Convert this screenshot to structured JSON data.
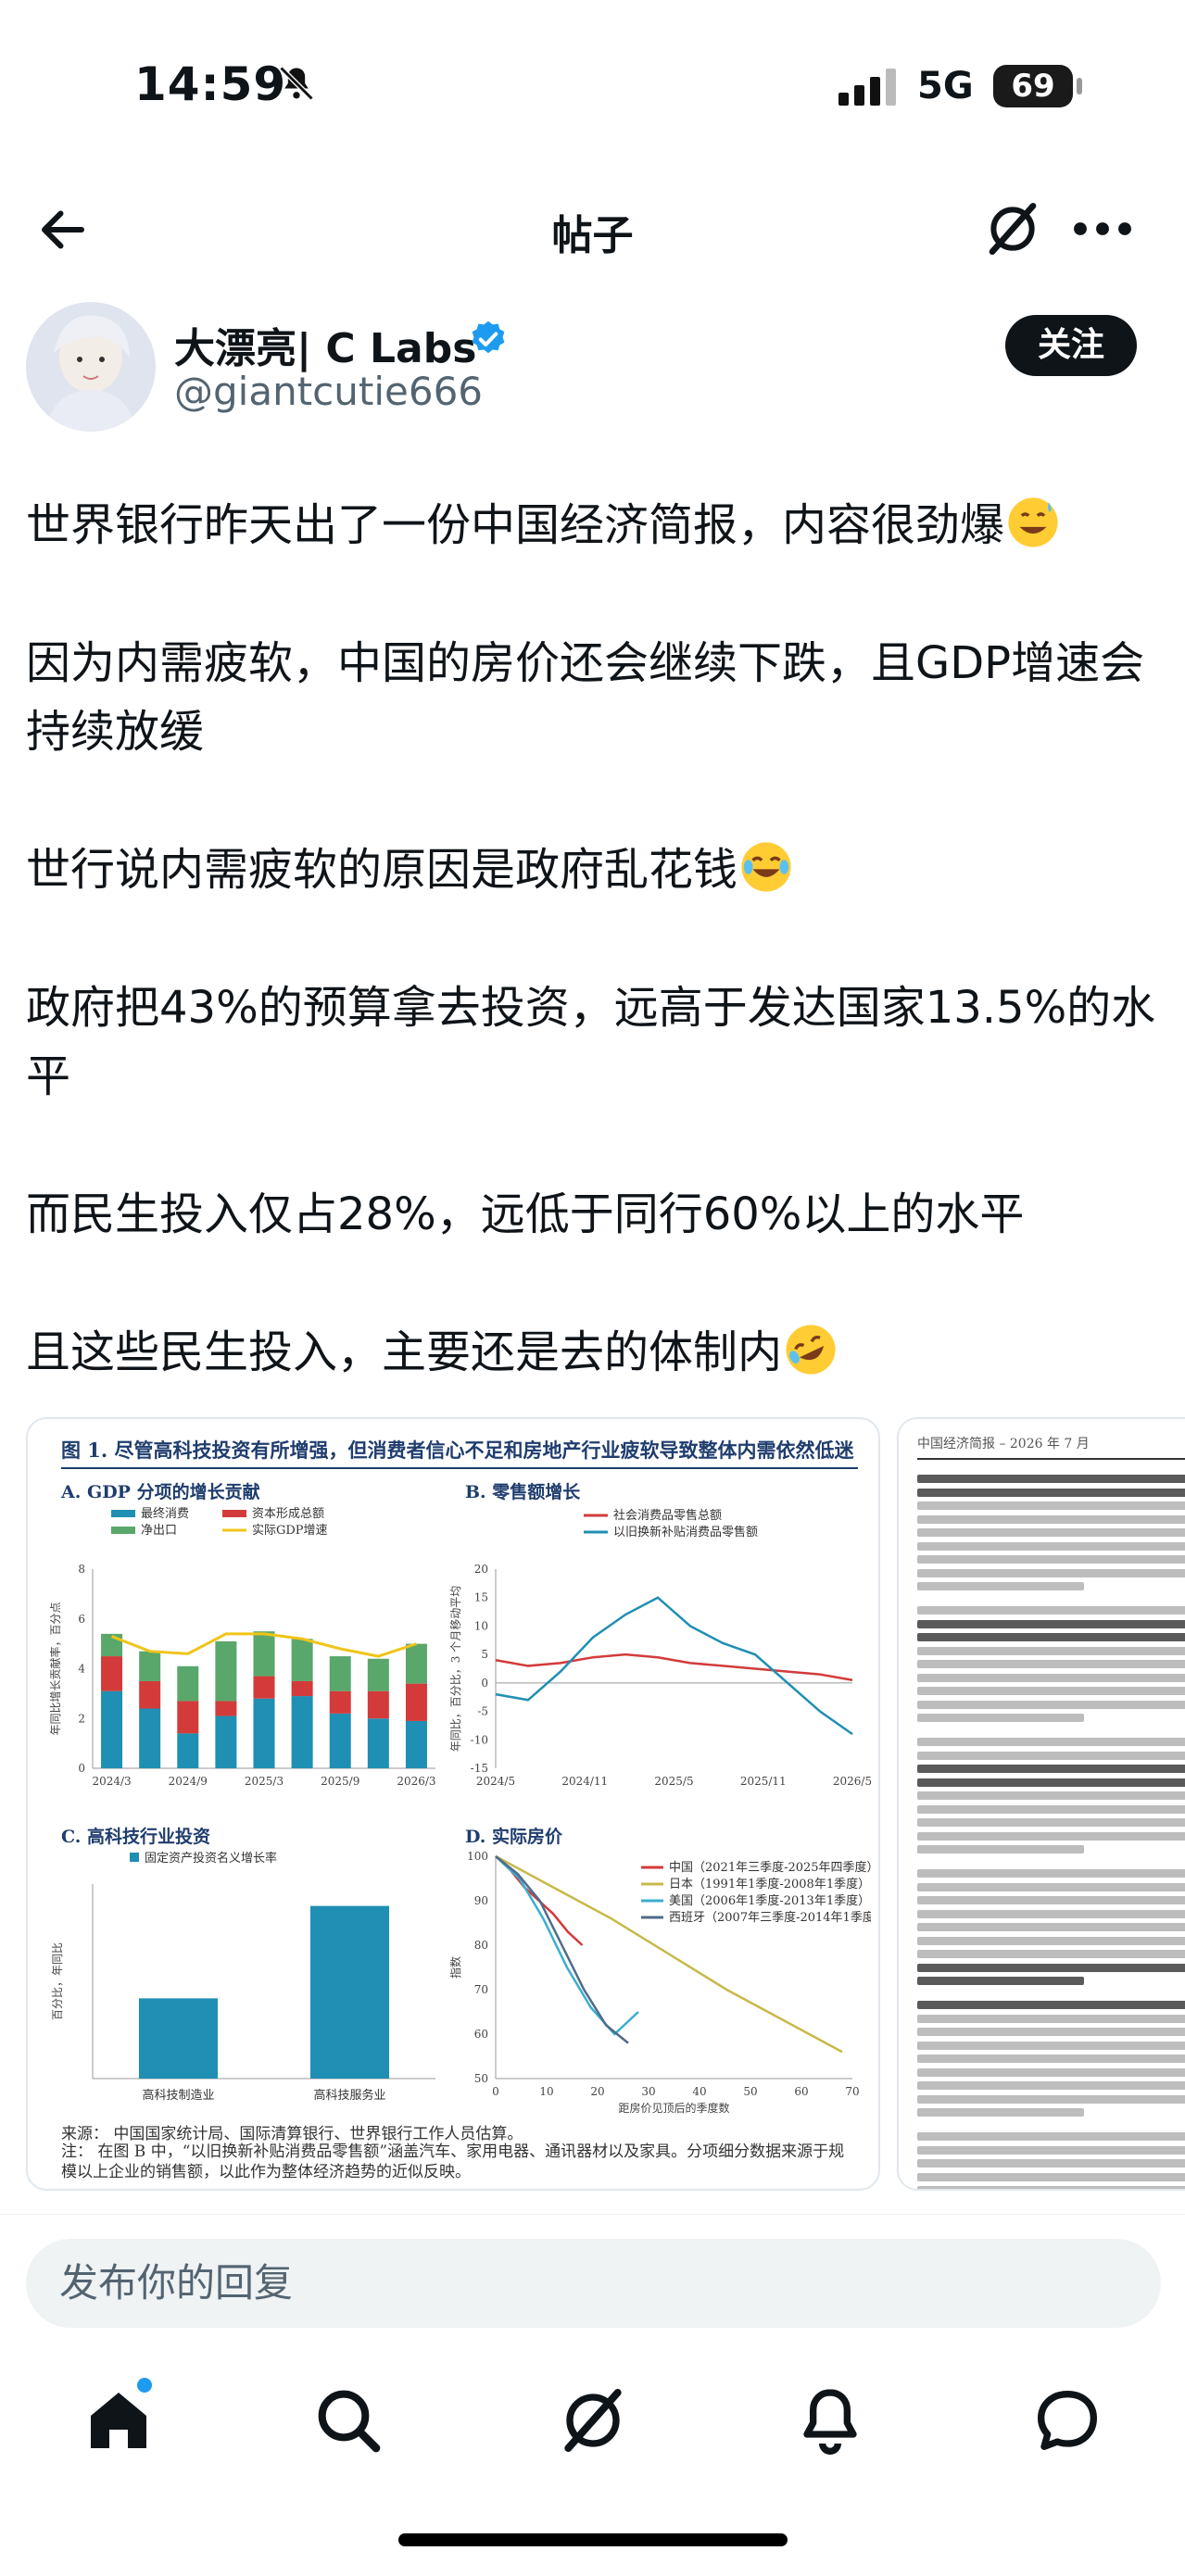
{
  "status_bar": {
    "time": "14:59",
    "network": "5G",
    "battery": "69"
  },
  "header": {
    "title": "帖子"
  },
  "author": {
    "name": "大漂亮| C Labs",
    "handle": "@giantcutie666",
    "follow_label": "关注"
  },
  "post": {
    "paragraphs": [
      "世界银行昨天出了一份中国经济简报，内容很劲爆",
      "因为内需疲软，中国的房价还会继续下跌，且GDP增速会持续放缓",
      "世行说内需疲软的原因是政府乱花钱",
      "政府把43%的预算拿去投资，远高于发达国家13.5%的水平",
      "而民生投入仅占28%，远低于同行60%以上的水平",
      "且这些民生投入，主要还是去的体制内"
    ],
    "emojis": [
      "grinning-sweat-emoji",
      "tears-of-joy-emoji",
      "rofl-emoji"
    ]
  },
  "figure": {
    "title": "图 1. 尽管高科技投资有所增强，但消费者信心不足和房地产行业疲软导致整体内需依然低迷",
    "source": "来源：  中国国家统计局、国际清算银行、世界银行工作人员估算。",
    "note": "注：  在图 B 中，“以旧换新补贴消费品零售额”涵盖汽车、家用电器、通讯器材以及家具。分项细分数据来源于规模以上企业的销售额，以此作为整体经济趋势的近似反映。"
  },
  "chart_data": [
    {
      "type": "bar",
      "title": "A. GDP 分项的增长贡献",
      "ylabel": "年同比增长贡献率，百分点",
      "categories": [
        "2024/3",
        "",
        "2024/9",
        "",
        "2025/3",
        "",
        "2025/9",
        "",
        "2026/3"
      ],
      "series": [
        {
          "name": "最终消费",
          "color": "#1f8fb3",
          "values": [
            3.1,
            2.4,
            1.4,
            2.1,
            2.8,
            2.9,
            2.2,
            2.0,
            1.9
          ]
        },
        {
          "name": "资本形成总额",
          "color": "#d33b3b",
          "values": [
            1.4,
            1.1,
            1.3,
            0.6,
            0.9,
            0.6,
            0.9,
            1.1,
            1.5
          ]
        },
        {
          "name": "净出口",
          "color": "#5aa76b",
          "values": [
            0.9,
            1.2,
            1.4,
            2.4,
            1.8,
            1.7,
            1.4,
            1.3,
            1.6
          ]
        }
      ],
      "line_series": {
        "name": "实际GDP增速",
        "color": "#f0c419",
        "values": [
          5.3,
          4.7,
          4.6,
          5.4,
          5.4,
          5.2,
          4.8,
          4.5,
          5.0
        ]
      },
      "ylim": [
        0,
        8
      ]
    },
    {
      "type": "line",
      "title": "B. 零售额增长",
      "ylabel": "年同比，百分比，3 个月移动平均",
      "x": [
        "2024/5",
        "2024/11",
        "2025/5",
        "2025/11",
        "2026/5"
      ],
      "series": [
        {
          "name": "社会消费品零售总额",
          "color": "#d33b3b",
          "values": [
            4,
            3,
            3.5,
            4.5,
            5,
            4.5,
            3.5,
            3,
            2.5,
            2,
            1.5,
            0.5
          ]
        },
        {
          "name": "以旧换新补贴消费品零售额",
          "color": "#1f8fb3",
          "values": [
            -2,
            -3,
            2,
            8,
            12,
            15,
            10,
            7,
            5,
            0,
            -5,
            -9
          ]
        }
      ],
      "ylim": [
        -15,
        20
      ]
    },
    {
      "type": "bar",
      "title": "C. 高科技行业投资",
      "ylabel": "百分比，年同比",
      "categories": [
        "高科技制造业",
        "高科技服务业"
      ],
      "series": [
        {
          "name": "固定资产投资名义增长率",
          "color": "#1f8fb3",
          "values": [
            3.3,
            7.1
          ]
        }
      ]
    },
    {
      "type": "line",
      "title": "D. 实际房价",
      "ylabel": "指数",
      "xlabel": "距房价见顶后的季度数",
      "xlim": [
        0,
        70
      ],
      "ylim": [
        50,
        100
      ],
      "series": [
        {
          "name": "中国（2021年三季度-2025年四季度）",
          "color": "#d33b3b",
          "values": [
            100,
            97,
            93,
            90,
            87,
            83,
            80
          ]
        },
        {
          "name": "日本（1991年1季度-2008年1季度）",
          "color": "#c8b94a",
          "values": [
            100,
            93,
            86,
            78,
            70,
            63,
            56
          ]
        },
        {
          "name": "美国（2006年1季度-2013年1季度）",
          "color": "#3aaed0",
          "values": [
            100,
            95,
            86,
            75,
            66,
            60,
            65
          ]
        },
        {
          "name": "西班牙（2007年三季度-2014年1季度）",
          "color": "#4f6b8a",
          "values": [
            100,
            96,
            90,
            80,
            70,
            62,
            58
          ]
        }
      ]
    }
  ],
  "second_card": {
    "header": "中国经济简报 – 2026 年 7 月"
  },
  "reply": {
    "placeholder": "发布你的回复"
  }
}
